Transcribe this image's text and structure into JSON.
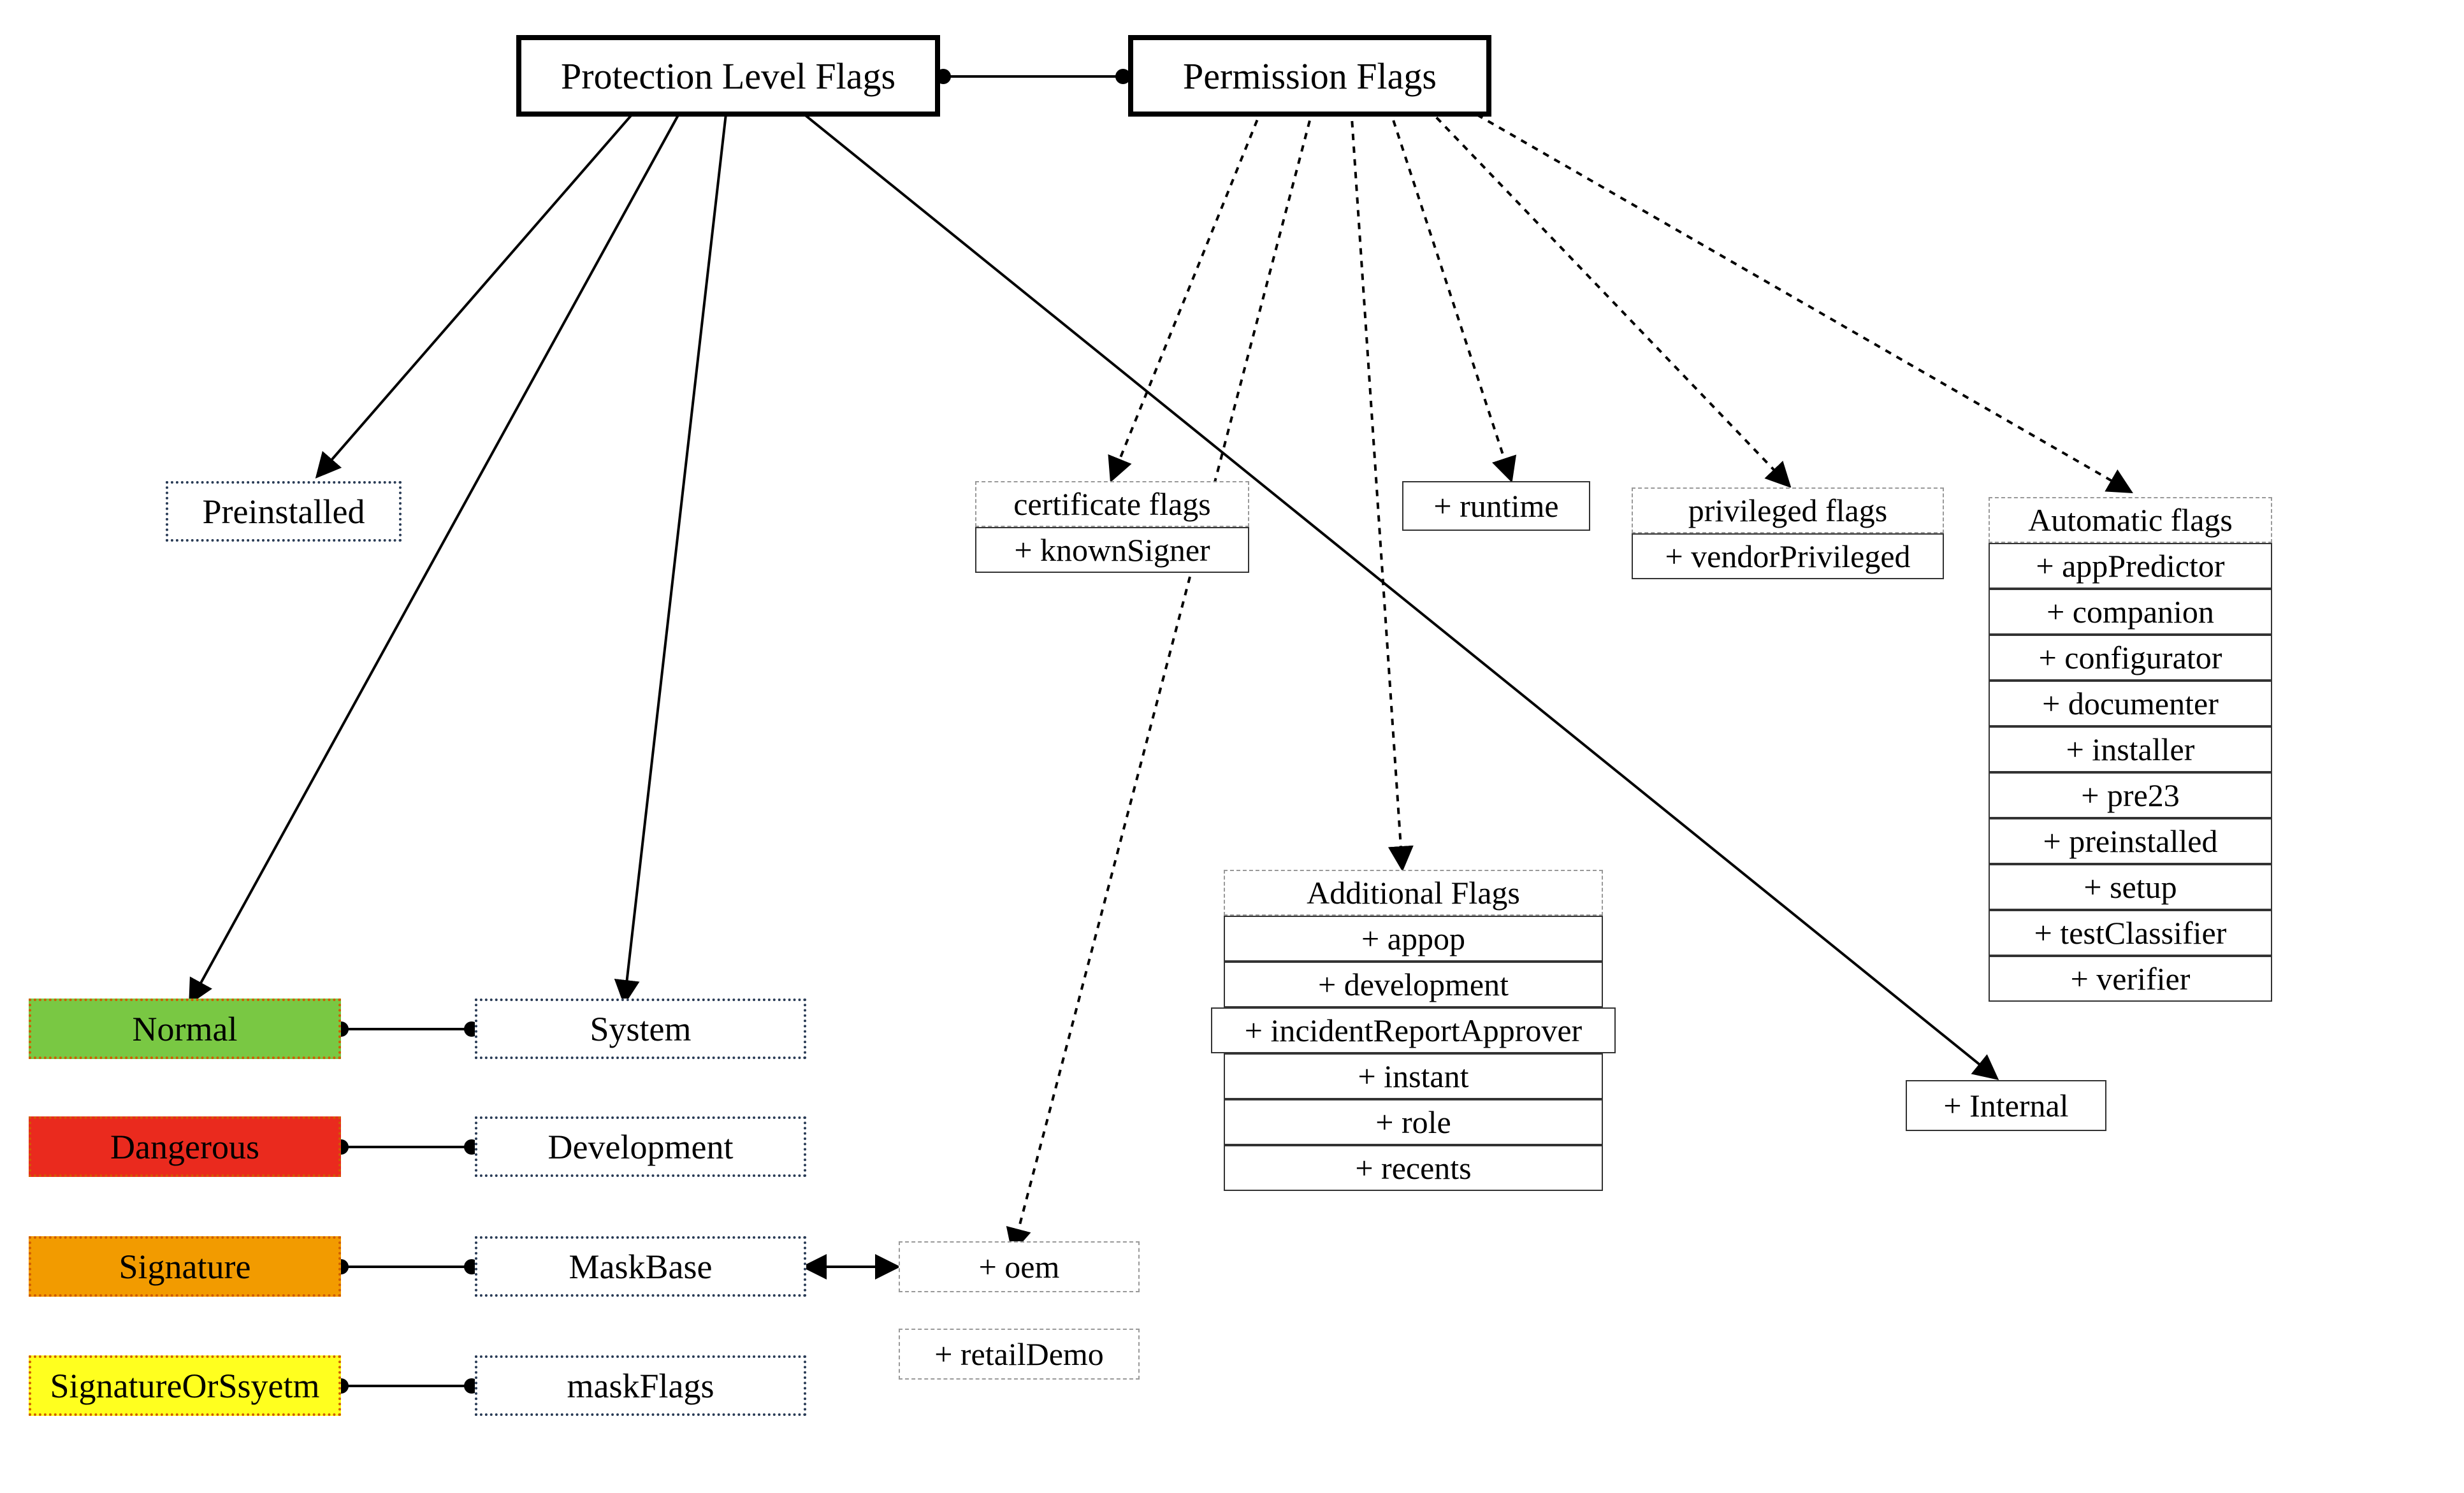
{
  "roots": {
    "protection": "Protection Level Flags",
    "permission": "Permission Flags"
  },
  "preinstalled": "Preinstalled",
  "levels": {
    "normal": "Normal",
    "dangerous": "Dangerous",
    "signature": "Signature",
    "sigOrSys": "SignatureOrSsyetm"
  },
  "right": {
    "system": "System",
    "development": "Development",
    "maskBase": "MaskBase",
    "maskFlags": "maskFlags"
  },
  "oem_group": {
    "oem": "+ oem",
    "retailDemo": "+ retailDemo"
  },
  "certificate": {
    "title": "certificate flags",
    "items": [
      "+ knownSigner"
    ]
  },
  "runtime": "+ runtime",
  "privileged": {
    "title": "privileged flags",
    "items": [
      "+ vendorPrivileged"
    ]
  },
  "automatic": {
    "title": "Automatic flags",
    "items": [
      "+ appPredictor",
      "+ companion",
      "+ configurator",
      "+ documenter",
      "+ installer",
      "+ pre23",
      "+ preinstalled",
      "+ setup",
      "+ testClassifier",
      "+ verifier"
    ]
  },
  "additional": {
    "title": "Additional Flags",
    "items": [
      "+      appop",
      "+ development",
      "+ incidentReportApprover",
      "+ instant",
      "+ role",
      "+ recents"
    ]
  },
  "internal": "+ Internal"
}
